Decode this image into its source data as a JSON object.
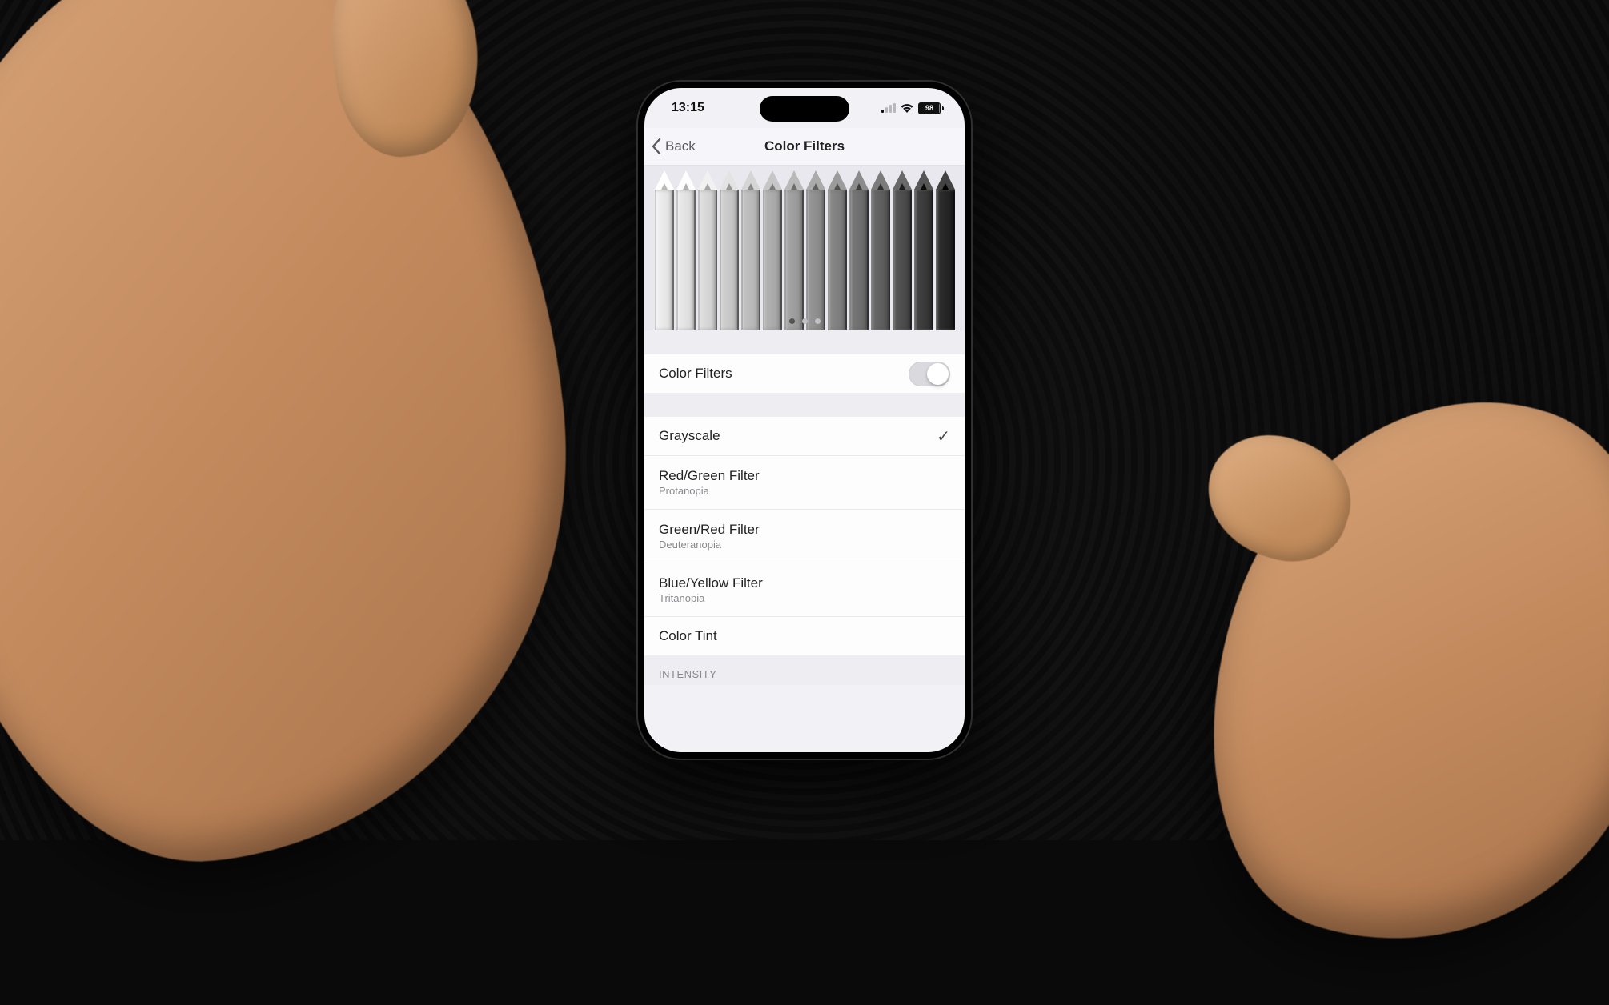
{
  "status_bar": {
    "time": "13:15",
    "battery_pct": "98"
  },
  "nav": {
    "back_label": "Back",
    "title": "Color Filters"
  },
  "preview": {
    "page_count": 3,
    "active_page": 0
  },
  "toggle_row": {
    "label": "Color Filters",
    "on": true
  },
  "filters": [
    {
      "label": "Grayscale",
      "sub": "",
      "selected": true
    },
    {
      "label": "Red/Green Filter",
      "sub": "Protanopia",
      "selected": false
    },
    {
      "label": "Green/Red Filter",
      "sub": "Deuteranopia",
      "selected": false
    },
    {
      "label": "Blue/Yellow Filter",
      "sub": "Tritanopia",
      "selected": false
    },
    {
      "label": "Color Tint",
      "sub": "",
      "selected": false
    }
  ],
  "intensity_header": "INTENSITY",
  "pencil_shades": [
    "#f4f4f4",
    "#eeeeee",
    "#e2e2e2",
    "#d4d4d4",
    "#c6c6c6",
    "#b7b7b7",
    "#aaaaaa",
    "#9b9b9b",
    "#8c8c8c",
    "#7c7c7c",
    "#6c6c6c",
    "#5a5a5a",
    "#474747",
    "#333333"
  ]
}
